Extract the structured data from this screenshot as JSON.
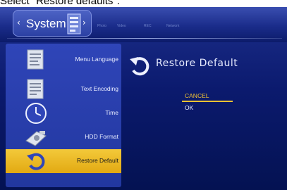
{
  "caption": "Select \"Restore defaults\".",
  "topbar": {
    "active_tab": "System",
    "left_arrow": "‹",
    "right_arrow": "›",
    "other_tabs": [
      "Photo",
      "Video",
      "REC",
      "Network"
    ]
  },
  "sidebar": {
    "items": [
      {
        "label": "Menu Language",
        "icon": "language-document-icon"
      },
      {
        "label": "Text Encoding",
        "icon": "encoding-document-icon"
      },
      {
        "label": "Time",
        "icon": "clock-icon"
      },
      {
        "label": "HDD Format",
        "icon": "hdd-icon"
      },
      {
        "label": "Restore Default",
        "icon": "restore-arrow-icon",
        "selected": true
      }
    ]
  },
  "main": {
    "title": "Restore Default",
    "options": [
      {
        "label": "CANCEL",
        "selected": true
      },
      {
        "label": "OK",
        "selected": false
      }
    ]
  },
  "colors": {
    "highlight": "#f1c232",
    "background": "#0b1a6e",
    "sidebar": "#2f45b8"
  }
}
